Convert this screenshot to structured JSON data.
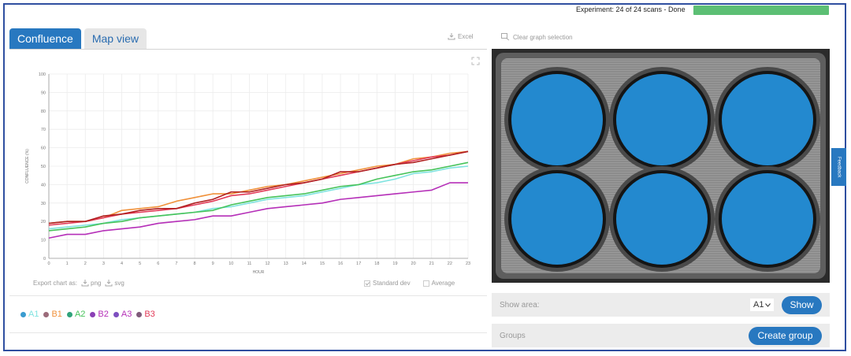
{
  "experiment": {
    "status": "Experiment: 24 of 24 scans - Done",
    "progress": 1.0
  },
  "tabs": [
    {
      "label": "Confluence",
      "active": true
    },
    {
      "label": "Map view",
      "active": false
    }
  ],
  "toolbar": {
    "excel_label": "Excel",
    "clear_label": "Clear graph selection"
  },
  "export": {
    "label": "Export chart as:",
    "png_label": "png",
    "svg_label": "svg"
  },
  "options": {
    "stddev_label": "Standard dev",
    "stddev_checked": true,
    "average_label": "Average",
    "average_checked": false
  },
  "chart_data": {
    "type": "line",
    "xlabel": "HOUR",
    "ylabel": "CONFLUENCE (%)",
    "xlim": [
      0,
      23
    ],
    "ylim": [
      0,
      100
    ],
    "x_ticks": [
      0,
      1,
      2,
      3,
      4,
      5,
      6,
      7,
      8,
      9,
      10,
      11,
      12,
      13,
      14,
      15,
      16,
      17,
      18,
      19,
      20,
      21,
      22,
      23
    ],
    "y_ticks": [
      0,
      10,
      20,
      30,
      40,
      50,
      60,
      70,
      80,
      90,
      100
    ],
    "grid": true,
    "x": [
      0,
      1,
      2,
      3,
      4,
      5,
      6,
      7,
      8,
      9,
      10,
      11,
      12,
      13,
      14,
      15,
      16,
      17,
      18,
      19,
      20,
      21,
      22,
      23
    ],
    "series": [
      {
        "name": "A1",
        "color": "#7fe3e0",
        "values": [
          16,
          17,
          18,
          19,
          21,
          22,
          23,
          24,
          25,
          27,
          28,
          30,
          32,
          33,
          34,
          36,
          38,
          40,
          41,
          43,
          46,
          47,
          49,
          50
        ]
      },
      {
        "name": "B1",
        "color": "#f0913a",
        "values": [
          19,
          20,
          20,
          22,
          26,
          27,
          28,
          31,
          33,
          35,
          35,
          37,
          39,
          40,
          42,
          44,
          46,
          48,
          50,
          51,
          54,
          55,
          57,
          58
        ]
      },
      {
        "name": "A2",
        "color": "#46c35a",
        "values": [
          15,
          16,
          17,
          19,
          20,
          22,
          23,
          24,
          25,
          26,
          29,
          31,
          33,
          34,
          35,
          37,
          39,
          40,
          43,
          45,
          47,
          48,
          50,
          52
        ]
      },
      {
        "name": "B2",
        "color": "#b52fb8",
        "values": [
          11,
          13,
          13,
          15,
          16,
          17,
          19,
          20,
          21,
          23,
          23,
          25,
          27,
          28,
          29,
          30,
          32,
          33,
          34,
          35,
          36,
          37,
          41,
          41
        ]
      },
      {
        "name": "A3",
        "color": "#e23a58",
        "values": [
          18,
          19,
          20,
          22,
          24,
          25,
          26,
          27,
          29,
          31,
          34,
          35,
          37,
          39,
          41,
          43,
          45,
          47,
          49,
          51,
          53,
          55,
          56,
          58
        ]
      },
      {
        "name": "B3",
        "color": "#b02020",
        "values": [
          19,
          20,
          20,
          23,
          24,
          26,
          27,
          27,
          30,
          32,
          36,
          36,
          38,
          40,
          41,
          43,
          47,
          47,
          49,
          51,
          52,
          54,
          56,
          58
        ]
      }
    ]
  },
  "legend": [
    {
      "label": "A1",
      "dot": "#3a9cd0",
      "color": "#7fe3e0"
    },
    {
      "label": "B1",
      "dot": "#9b6b7a",
      "color": "#f0913a"
    },
    {
      "label": "A2",
      "dot": "#2fa37a",
      "color": "#46c35a"
    },
    {
      "label": "B2",
      "dot": "#8a3fb5",
      "color": "#b52fb8"
    },
    {
      "label": "A3",
      "dot": "#7d4fc0",
      "color": "#b52fb8"
    },
    {
      "label": "B3",
      "dot": "#7f5a7a",
      "color": "#e23a58"
    }
  ],
  "show_area": {
    "label": "Show area:",
    "selected": "A1",
    "button": "Show"
  },
  "groups": {
    "label": "Groups",
    "button": "Create group"
  },
  "feedback": {
    "label": "Feedback"
  },
  "colors": {
    "accent": "#2878c0",
    "well": "#2389cf",
    "progress": "#5cbf74"
  }
}
